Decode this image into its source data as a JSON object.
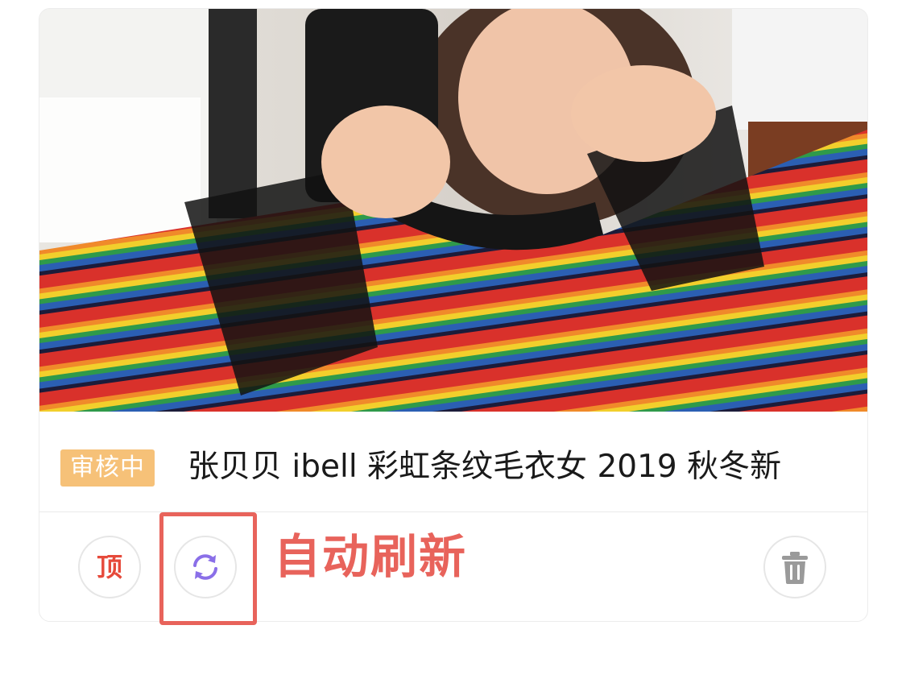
{
  "listing": {
    "status_badge": "审核中",
    "title": "张贝贝 ibell 彩虹条纹毛衣女 2019 秋冬新"
  },
  "actions": {
    "top_label": "顶",
    "refresh_icon": "refresh-icon",
    "delete_icon": "trash-icon"
  },
  "annotation": {
    "text": "自动刷新"
  },
  "colors": {
    "badge": "#f6c178",
    "top_label": "#e64a3b",
    "refresh_icon": "#8a6fe8",
    "delete_icon": "#9a9a9a",
    "highlight": "#e8635b"
  }
}
